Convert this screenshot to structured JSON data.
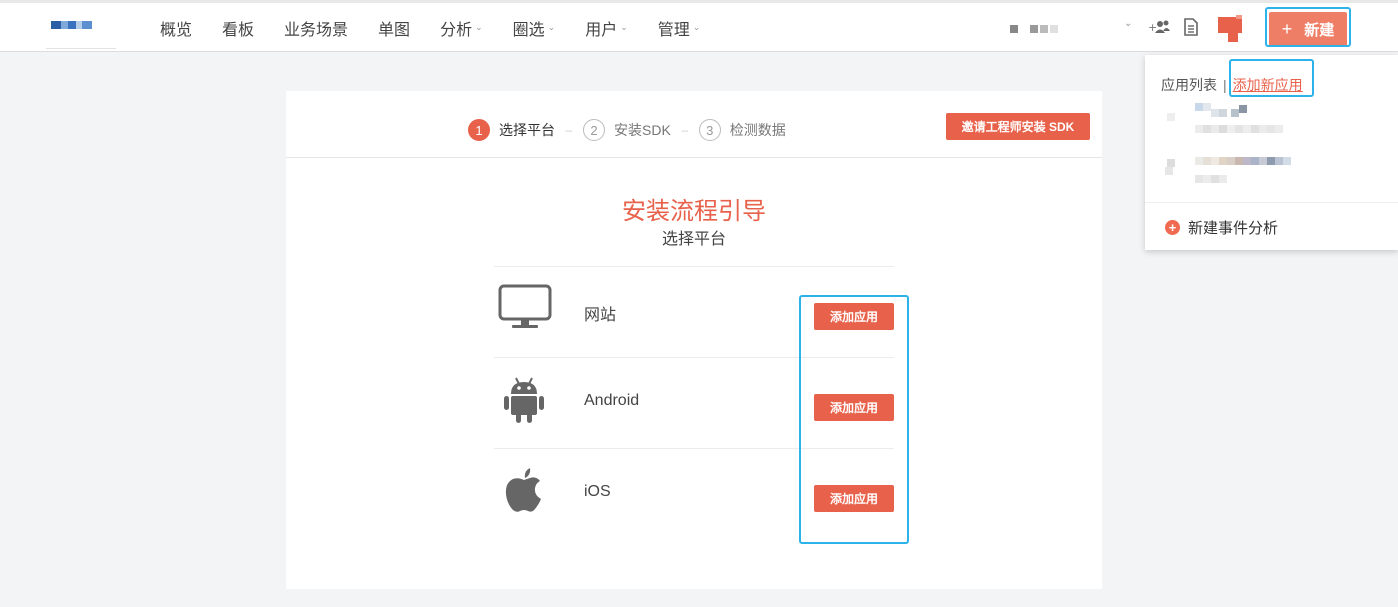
{
  "nav": {
    "items": [
      {
        "label": "概览",
        "has_menu": false
      },
      {
        "label": "看板",
        "has_menu": false
      },
      {
        "label": "业务场景",
        "has_menu": false
      },
      {
        "label": "单图",
        "has_menu": false
      },
      {
        "label": "分析",
        "has_menu": true
      },
      {
        "label": "圈选",
        "has_menu": true
      },
      {
        "label": "用户",
        "has_menu": true
      },
      {
        "label": "管理",
        "has_menu": true
      }
    ],
    "chevron": "⌄",
    "new_button": {
      "plus": "+",
      "label": "新建"
    }
  },
  "dropdown": {
    "list_label": "应用列表",
    "separator": "|",
    "add_link": "添加新应用",
    "new_event": {
      "icon": "+",
      "label": "新建事件分析"
    }
  },
  "steps": [
    {
      "num": "1",
      "label": "选择平台",
      "active": true
    },
    {
      "num": "2",
      "label": "安装SDK",
      "active": false
    },
    {
      "num": "3",
      "label": "检测数据",
      "active": false
    }
  ],
  "step_gap": "–",
  "invite_button": "邀请工程师安装 SDK",
  "guide": {
    "title": "安装流程引导",
    "subtitle": "选择平台"
  },
  "platforms": [
    {
      "name": "网站",
      "icon": "monitor-icon",
      "button": "添加应用"
    },
    {
      "name": "Android",
      "icon": "android-icon",
      "button": "添加应用"
    },
    {
      "name": "iOS",
      "icon": "apple-icon",
      "button": "添加应用"
    }
  ],
  "colors": {
    "accent": "#e8614a",
    "highlight": "#2bb3ea",
    "new_button": "#ef7e67"
  }
}
